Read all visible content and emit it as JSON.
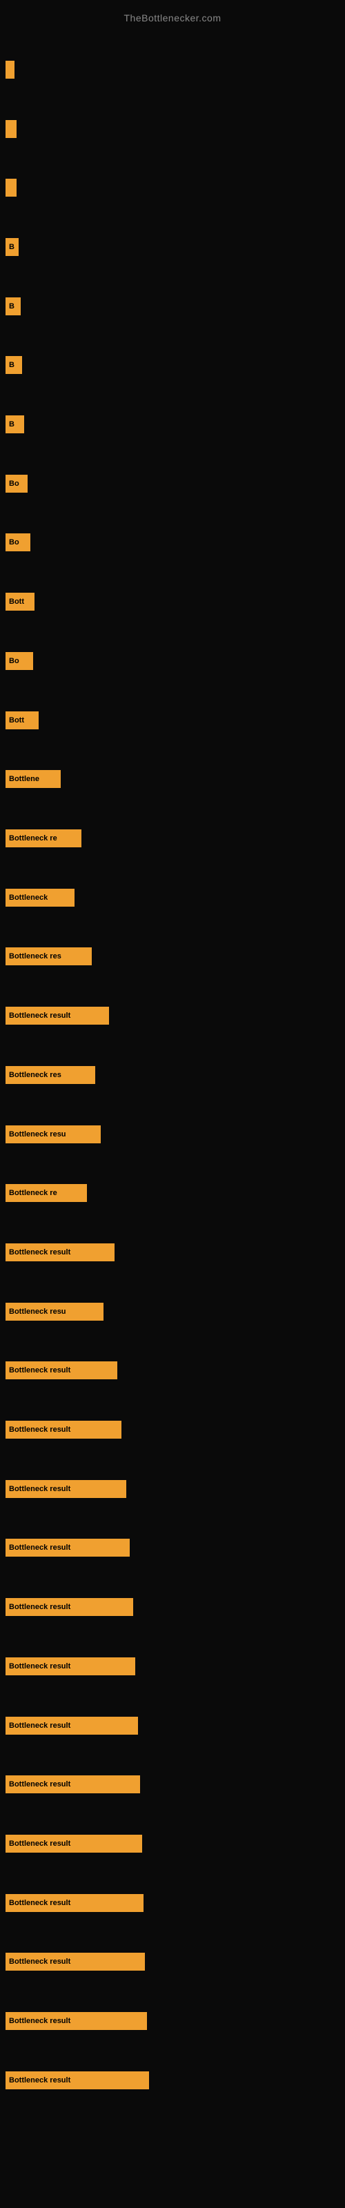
{
  "site": {
    "title": "TheBottlenecker.com"
  },
  "bars": [
    {
      "label": "",
      "width": 3,
      "text": ""
    },
    {
      "label": "",
      "width": 6,
      "text": ""
    },
    {
      "label": "",
      "width": 6,
      "text": ""
    },
    {
      "label": "B",
      "width": 9,
      "text": "B"
    },
    {
      "label": "B",
      "width": 12,
      "text": "B"
    },
    {
      "label": "B",
      "width": 14,
      "text": "B"
    },
    {
      "label": "B",
      "width": 17,
      "text": "B"
    },
    {
      "label": "Bo",
      "width": 22,
      "text": "Bo"
    },
    {
      "label": "Bo",
      "width": 26,
      "text": "Bo"
    },
    {
      "label": "Bott",
      "width": 32,
      "text": "Bott"
    },
    {
      "label": "Bo",
      "width": 30,
      "text": "Bo"
    },
    {
      "label": "Bott",
      "width": 38,
      "text": "Bott"
    },
    {
      "label": "Bottlene",
      "width": 70,
      "text": "Bottlene"
    },
    {
      "label": "Bottleneck re",
      "width": 100,
      "text": "Bottleneck re"
    },
    {
      "label": "Bottleneck",
      "width": 90,
      "text": "Bottleneck"
    },
    {
      "label": "Bottleneck res",
      "width": 115,
      "text": "Bottleneck res"
    },
    {
      "label": "Bottleneck result",
      "width": 140,
      "text": "Bottleneck result"
    },
    {
      "label": "Bottleneck res",
      "width": 120,
      "text": "Bottleneck res"
    },
    {
      "label": "Bottleneck resu",
      "width": 128,
      "text": "Bottleneck resu"
    },
    {
      "label": "Bottleneck re",
      "width": 108,
      "text": "Bottleneck re"
    },
    {
      "label": "Bottleneck result",
      "width": 148,
      "text": "Bottleneck result"
    },
    {
      "label": "Bottleneck resu",
      "width": 132,
      "text": "Bottleneck resu"
    },
    {
      "label": "Bottleneck result",
      "width": 152,
      "text": "Bottleneck result"
    },
    {
      "label": "Bottleneck result",
      "width": 158,
      "text": "Bottleneck result"
    },
    {
      "label": "Bottleneck result",
      "width": 165,
      "text": "Bottleneck result"
    },
    {
      "label": "Bottleneck result",
      "width": 170,
      "text": "Bottleneck result"
    },
    {
      "label": "Bottleneck result",
      "width": 175,
      "text": "Bottleneck result"
    },
    {
      "label": "Bottleneck result",
      "width": 178,
      "text": "Bottleneck result"
    },
    {
      "label": "Bottleneck result",
      "width": 182,
      "text": "Bottleneck result"
    },
    {
      "label": "Bottleneck result",
      "width": 185,
      "text": "Bottleneck result"
    },
    {
      "label": "Bottleneck result",
      "width": 188,
      "text": "Bottleneck result"
    },
    {
      "label": "Bottleneck result",
      "width": 190,
      "text": "Bottleneck result"
    },
    {
      "label": "Bottleneck result",
      "width": 192,
      "text": "Bottleneck result"
    },
    {
      "label": "Bottleneck result",
      "width": 195,
      "text": "Bottleneck result"
    },
    {
      "label": "Bottleneck result",
      "width": 198,
      "text": "Bottleneck result"
    }
  ]
}
